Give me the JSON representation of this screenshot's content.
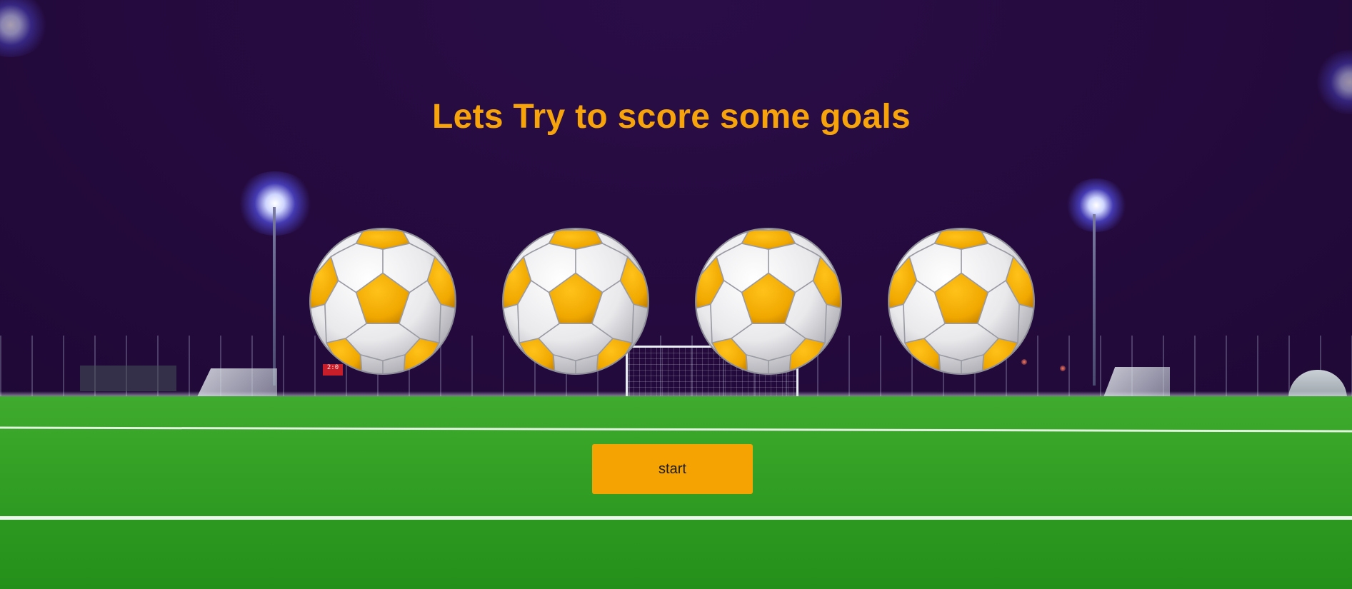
{
  "game": {
    "title": "Lets Try to score some goals",
    "start_label": "start"
  },
  "scoreboard_text": "2:0",
  "balls": [
    {
      "name": "soccer-ball-1",
      "icon": "soccer-ball-icon"
    },
    {
      "name": "soccer-ball-2",
      "icon": "soccer-ball-icon"
    },
    {
      "name": "soccer-ball-3",
      "icon": "soccer-ball-icon"
    },
    {
      "name": "soccer-ball-4",
      "icon": "soccer-ball-icon"
    }
  ],
  "colors": {
    "title": "#f7a30c",
    "button": "#f5a203",
    "ball_panel": "#f0a800",
    "sky": "#250b3f",
    "pitch": "#36a327"
  }
}
